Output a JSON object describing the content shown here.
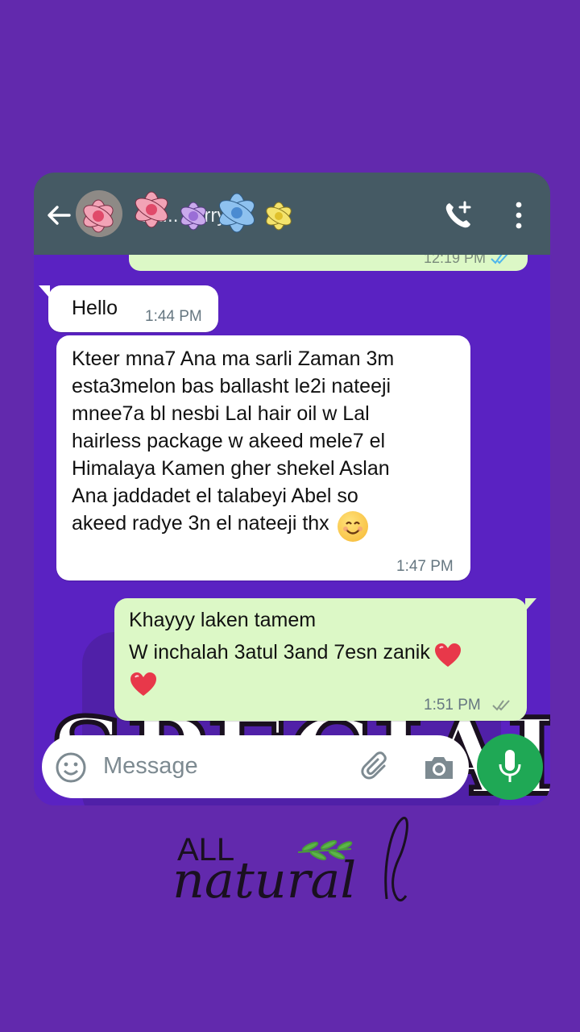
{
  "header": {
    "contact_name": "Sa... Jerry",
    "back_icon": "arrow-left-icon",
    "call_icon": "phone-plus-icon",
    "more_icon": "more-vertical-icon"
  },
  "previous_message": {
    "time": "12:19 PM"
  },
  "messages": [
    {
      "direction": "in",
      "text": "Hello",
      "time": "1:44 PM"
    },
    {
      "direction": "in",
      "text": "Kteer mna7 Ana ma sarli Zaman 3m\nesta3melon bas ballasht le2i nateeji\nmnee7a bl nesbi Lal hair oil w Lal\nhairless package w akeed mele7 el\nHimalaya Kamen gher shekel Aslan\nAna jaddadet el talabeyi Abel so\nakeed radye 3n el nateeji thx",
      "emoji": "smiling-face-icon",
      "time": "1:47 PM"
    },
    {
      "direction": "out",
      "line1": "Khayyy laken tamem",
      "line2": "W inchalah 3atul 3and 7esn zanik",
      "time": "1:51 PM"
    }
  ],
  "input": {
    "placeholder": "Message"
  },
  "logo": {
    "text_all": "ALL",
    "text_natural": "natural"
  },
  "background_word": "SPECIAL",
  "colors": {
    "page_bg": "#6229ad",
    "header_bg": "#455a64",
    "incoming": "#ffffff",
    "outgoing": "#dcf8c6",
    "mic": "#1fa855"
  }
}
